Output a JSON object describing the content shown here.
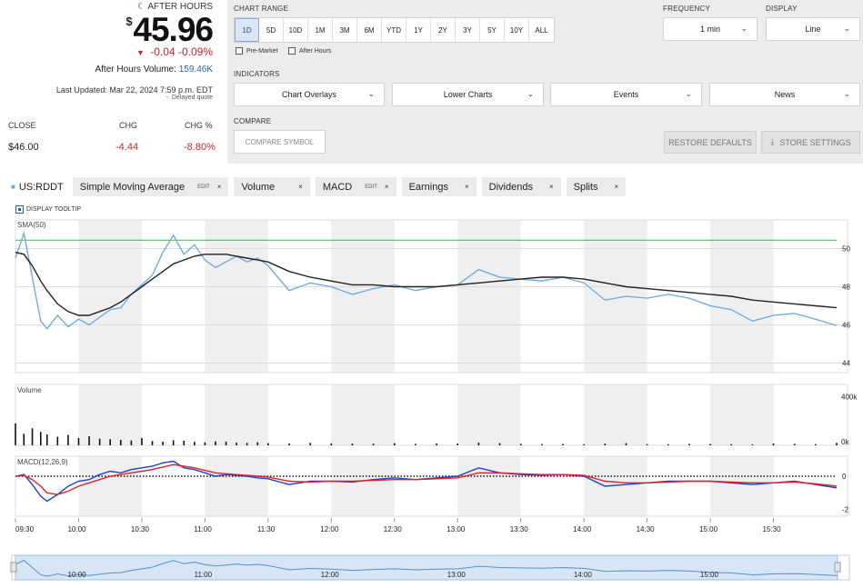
{
  "quote": {
    "after_hours_label": "AFTER HOURS",
    "currency": "$",
    "price": "45.96",
    "change": "-0.04",
    "change_pct": "-0.09%",
    "ah_volume_label": "After Hours Volume:",
    "ah_volume": "159.46K",
    "last_updated": "Last Updated: Mar 22, 2024 7:59 p.m. EDT",
    "delayed": "Delayed quote",
    "table": {
      "headers": [
        "CLOSE",
        "CHG",
        "CHG %"
      ],
      "values": [
        "$46.00",
        "-4.44",
        "-8.80%"
      ]
    }
  },
  "controls": {
    "chart_range_label": "CHART RANGE",
    "ranges": [
      "1D",
      "5D",
      "10D",
      "1M",
      "3M",
      "6M",
      "YTD",
      "1Y",
      "2Y",
      "3Y",
      "5Y",
      "10Y",
      "ALL"
    ],
    "selected_range": "1D",
    "premarket_label": "Pre-Market",
    "afterhours_label": "After Hours",
    "frequency_label": "FREQUENCY",
    "frequency_value": "1 min",
    "display_label": "DISPLAY",
    "display_value": "Line",
    "indicators_label": "INDICATORS",
    "indicator_dropdowns": [
      "Chart Overlays",
      "Lower Charts",
      "Events",
      "News"
    ],
    "compare_label": "COMPARE",
    "compare_placeholder": "COMPARE SYMBOL",
    "restore_label": "RESTORE DEFAULTS",
    "store_label": "STORE SETTINGS"
  },
  "tabs": {
    "symbol": "US:RDDT",
    "items": [
      {
        "label": "Simple Moving Average",
        "edit": "EDIT"
      },
      {
        "label": "Volume",
        "edit": ""
      },
      {
        "label": "MACD",
        "edit": "EDIT"
      },
      {
        "label": "Earnings",
        "edit": ""
      },
      {
        "label": "Dividends",
        "edit": ""
      },
      {
        "label": "Splits",
        "edit": ""
      }
    ],
    "close": "×",
    "display_tooltip": "DISPLAY TOOLTIP"
  },
  "colors": {
    "price_line": "#6aa8dc",
    "sma_line": "#222222",
    "ref_line": "#4caf50",
    "negative": "#c6262e",
    "macd": "#1f3fd0",
    "signal": "#e0202a",
    "band": "#efefef"
  },
  "chart_data": {
    "type": "line",
    "panels": {
      "price_label": "SMA(50)",
      "volume_label": "Volume",
      "macd_label": "MACD(12,26,9)"
    },
    "x_ticks": [
      "09:30",
      "10:00",
      "10:30",
      "11:00",
      "11:30",
      "12:00",
      "12:30",
      "13:00",
      "13:30",
      "14:00",
      "14:30",
      "15:00",
      "15:30"
    ],
    "navigator_ticks": [
      "10:00",
      "11:00",
      "12:00",
      "13:00",
      "14:00",
      "15:00"
    ],
    "y_ticks": [
      50,
      48,
      46,
      44
    ],
    "ylim": [
      43.5,
      51.5
    ],
    "volume_ticks": [
      "400k",
      "0k"
    ],
    "macd_ticks": [
      0,
      -2
    ],
    "reference_line": 50.44,
    "minutes": [
      0,
      4,
      8,
      12,
      15,
      20,
      25,
      30,
      35,
      40,
      45,
      50,
      55,
      60,
      65,
      70,
      75,
      80,
      85,
      90,
      95,
      100,
      105,
      110,
      115,
      120,
      130,
      140,
      150,
      160,
      170,
      180,
      190,
      200,
      210,
      220,
      230,
      240,
      250,
      260,
      270,
      280,
      290,
      300,
      310,
      320,
      330,
      340,
      350,
      360,
      370,
      380,
      390
    ],
    "price": [
      49.5,
      50.8,
      48.5,
      46.2,
      45.8,
      46.5,
      45.9,
      46.3,
      46.0,
      46.4,
      46.8,
      46.9,
      47.6,
      48.1,
      48.6,
      49.8,
      50.7,
      49.7,
      50.2,
      49.4,
      49.0,
      49.3,
      49.6,
      49.3,
      49.5,
      49.1,
      47.8,
      48.2,
      48.0,
      47.6,
      47.9,
      48.1,
      47.8,
      48.0,
      48.1,
      48.9,
      48.5,
      48.4,
      48.3,
      48.5,
      48.2,
      47.3,
      47.5,
      47.4,
      47.6,
      47.4,
      47.0,
      46.8,
      46.2,
      46.5,
      46.6,
      46.3,
      45.96
    ],
    "sma": [
      49.8,
      49.7,
      49.1,
      48.3,
      47.8,
      47.1,
      46.7,
      46.5,
      46.5,
      46.7,
      46.9,
      47.2,
      47.6,
      48.0,
      48.4,
      48.8,
      49.2,
      49.4,
      49.6,
      49.7,
      49.7,
      49.7,
      49.6,
      49.5,
      49.4,
      49.3,
      48.8,
      48.5,
      48.3,
      48.1,
      48.1,
      48.0,
      48.0,
      48.0,
      48.1,
      48.2,
      48.3,
      48.4,
      48.5,
      48.5,
      48.4,
      48.2,
      48.0,
      47.9,
      47.8,
      47.7,
      47.6,
      47.5,
      47.3,
      47.2,
      47.1,
      47.0,
      46.9
    ],
    "volume_max_k": 500,
    "volume_k": [
      180,
      95,
      140,
      110,
      90,
      70,
      85,
      60,
      75,
      55,
      50,
      45,
      40,
      60,
      35,
      30,
      42,
      38,
      28,
      25,
      32,
      30,
      22,
      20,
      25,
      18,
      15,
      20,
      16,
      14,
      13,
      18,
      12,
      15,
      14,
      22,
      18,
      12,
      10,
      11,
      9,
      14,
      18,
      10,
      9,
      12,
      11,
      9,
      8,
      15,
      12,
      10,
      20
    ],
    "macd_ylim": [
      -2.4,
      1.2
    ],
    "macd": [
      0.0,
      0.1,
      -0.5,
      -1.2,
      -1.5,
      -1.1,
      -0.6,
      -0.3,
      -0.2,
      0.1,
      0.3,
      0.2,
      0.4,
      0.5,
      0.6,
      0.8,
      0.9,
      0.5,
      0.4,
      0.2,
      0.0,
      0.1,
      0.05,
      0.0,
      -0.1,
      -0.15,
      -0.5,
      -0.3,
      -0.3,
      -0.35,
      -0.2,
      -0.1,
      -0.2,
      -0.1,
      0.0,
      0.5,
      0.2,
      0.1,
      0.05,
      0.1,
      0.0,
      -0.6,
      -0.5,
      -0.4,
      -0.3,
      -0.3,
      -0.3,
      -0.4,
      -0.5,
      -0.4,
      -0.3,
      -0.5,
      -0.7
    ],
    "signal": [
      0.0,
      0.05,
      -0.2,
      -0.6,
      -1.0,
      -1.1,
      -0.9,
      -0.6,
      -0.4,
      -0.2,
      0.0,
      0.1,
      0.2,
      0.3,
      0.4,
      0.55,
      0.7,
      0.6,
      0.5,
      0.35,
      0.2,
      0.15,
      0.1,
      0.05,
      0.0,
      -0.05,
      -0.3,
      -0.35,
      -0.3,
      -0.3,
      -0.25,
      -0.2,
      -0.2,
      -0.15,
      -0.1,
      0.2,
      0.2,
      0.15,
      0.1,
      0.1,
      0.05,
      -0.3,
      -0.4,
      -0.4,
      -0.35,
      -0.3,
      -0.3,
      -0.35,
      -0.4,
      -0.4,
      -0.35,
      -0.45,
      -0.6
    ]
  }
}
